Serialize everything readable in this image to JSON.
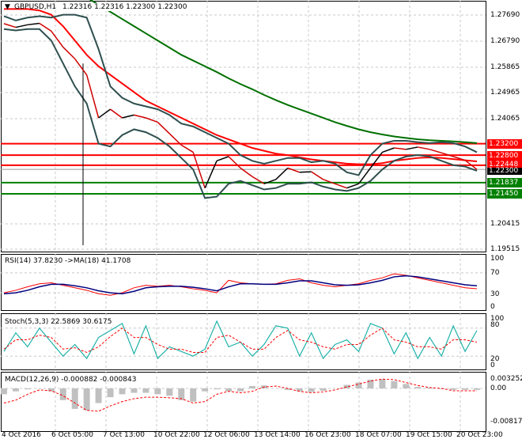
{
  "header": {
    "symbol": "GBPUSD,H1",
    "ohlc": "1.22316 1.22316 1.22300 1.22300"
  },
  "price_axis": [
    "1.27690",
    "1.26790",
    "1.25865",
    "1.24965",
    "1.24065",
    "1.20415",
    "1.19515"
  ],
  "levels": [
    {
      "label": "1.23200",
      "value": 1.232,
      "color": "#ff0000"
    },
    {
      "label": "1.22800",
      "value": 1.228,
      "color": "#ff0000"
    },
    {
      "label": "1.22448",
      "value": 1.22448,
      "color": "#ff0000"
    },
    {
      "label": "1.21837",
      "value": 1.21837,
      "color": "#008000"
    },
    {
      "label": "1.21450",
      "value": 1.2145,
      "color": "#008000"
    }
  ],
  "current_price": {
    "label": "1.22300",
    "value": 1.223
  },
  "rsi": {
    "title": "RSI(14) 37.8230  ->MA(18) 41.1708",
    "axis": [
      "100",
      "70",
      "30",
      "0"
    ]
  },
  "stoch": {
    "title": "Stoch(5,3,3) 22.5869 30.6175",
    "axis": [
      "100",
      "80",
      "20",
      "0"
    ]
  },
  "macd": {
    "title": "MACD(12,26,9) -0.000882 -0.000843",
    "axis": [
      "0.003252",
      "0.00",
      "-0.008171"
    ]
  },
  "time_axis": [
    "4 Oct 2016",
    "6 Oct 05:00",
    "7 Oct 13:00",
    "10 Oct 22:00",
    "12 Oct 06:00",
    "13 Oct 14:00",
    "16 Oct 23:00",
    "18 Oct 07:00",
    "19 Oct 15:00",
    "20 Oct 23:00"
  ],
  "chart_data": {
    "type": "line",
    "price": [
      1.2739,
      1.2726,
      1.2735,
      1.274,
      1.2713,
      1.2657,
      1.2616,
      1.256,
      1.241,
      1.244,
      1.241,
      1.242,
      1.241,
      1.2395,
      1.2355,
      1.2315,
      1.229,
      1.2165,
      1.226,
      1.2275,
      1.2235,
      1.2205,
      1.218,
      1.2195,
      1.2235,
      1.222,
      1.2222,
      1.2195,
      1.218,
      1.2165,
      1.218,
      1.2235,
      1.229,
      1.2305,
      1.23,
      1.2308,
      1.23,
      1.2288,
      1.2275,
      1.2262,
      1.223
    ],
    "ma_red": [
      1.279,
      1.279,
      1.279,
      1.2785,
      1.277,
      1.273,
      1.268,
      1.263,
      1.259,
      1.256,
      1.253,
      1.25,
      1.247,
      1.245,
      1.243,
      1.241,
      1.239,
      1.237,
      1.235,
      1.2335,
      1.232,
      1.2305,
      1.2295,
      1.2285,
      1.228,
      1.2272,
      1.2265,
      1.226,
      1.2255,
      1.225,
      1.2248,
      1.2248,
      1.2252,
      1.226,
      1.2265,
      1.227,
      1.2272,
      1.227,
      1.2266,
      1.2262,
      1.2258
    ],
    "ma_green": [
      1.285,
      1.285,
      1.285,
      1.285,
      1.285,
      1.285,
      1.284,
      1.283,
      1.2805,
      1.278,
      1.2755,
      1.273,
      1.2705,
      1.268,
      1.2655,
      1.263,
      1.261,
      1.259,
      1.257,
      1.2548,
      1.2528,
      1.251,
      1.249,
      1.2472,
      1.2455,
      1.244,
      1.2425,
      1.241,
      1.2395,
      1.2382,
      1.237,
      1.236,
      1.2352,
      1.2345,
      1.234,
      1.2335,
      1.2332,
      1.233,
      1.2328,
      1.2325,
      1.2322
    ],
    "bb_upper": [
      1.2765,
      1.275,
      1.276,
      1.2765,
      1.276,
      1.277,
      1.277,
      1.276,
      1.265,
      1.252,
      1.248,
      1.246,
      1.245,
      1.244,
      1.242,
      1.239,
      1.238,
      1.236,
      1.234,
      1.232,
      1.228,
      1.226,
      1.225,
      1.226,
      1.227,
      1.227,
      1.2255,
      1.226,
      1.225,
      1.222,
      1.221,
      1.228,
      1.232,
      1.233,
      1.233,
      1.2325,
      1.2322,
      1.2325,
      1.2322,
      1.231,
      1.229
    ],
    "bb_lower": [
      1.272,
      1.2715,
      1.272,
      1.272,
      1.268,
      1.26,
      1.252,
      1.246,
      1.232,
      1.231,
      1.235,
      1.237,
      1.236,
      1.234,
      1.231,
      1.227,
      1.223,
      1.213,
      1.2135,
      1.218,
      1.219,
      1.2175,
      1.216,
      1.2165,
      1.218,
      1.218,
      1.2185,
      1.217,
      1.216,
      1.2155,
      1.2165,
      1.219,
      1.223,
      1.226,
      1.2275,
      1.228,
      1.2275,
      1.226,
      1.2245,
      1.224,
      1.2225
    ],
    "rsi": [
      30,
      35,
      42,
      48,
      50,
      45,
      40,
      35,
      28,
      25,
      30,
      40,
      45,
      43,
      45,
      42,
      38,
      35,
      30,
      55,
      50,
      48,
      47,
      48,
      55,
      58,
      50,
      45,
      42,
      45,
      48,
      55,
      60,
      68,
      65,
      60,
      55,
      50,
      45,
      40,
      38
    ],
    "rsi_ma": [
      28,
      30,
      35,
      42,
      47,
      47,
      44,
      40,
      34,
      30,
      28,
      33,
      40,
      42,
      43,
      43,
      41,
      38,
      34,
      42,
      48,
      48,
      47,
      47,
      50,
      54,
      54,
      50,
      46,
      45,
      46,
      50,
      55,
      62,
      64,
      62,
      58,
      54,
      50,
      46,
      44
    ],
    "stoch_main": [
      30,
      70,
      40,
      80,
      50,
      20,
      45,
      15,
      60,
      75,
      90,
      25,
      85,
      15,
      40,
      30,
      20,
      35,
      95,
      40,
      50,
      20,
      45,
      85,
      80,
      20,
      70,
      15,
      45,
      55,
      30,
      90,
      80,
      25,
      70,
      15,
      60,
      20,
      85,
      30,
      75
    ],
    "stoch_signal": [
      35,
      55,
      55,
      65,
      60,
      35,
      38,
      28,
      40,
      62,
      80,
      60,
      60,
      45,
      35,
      35,
      28,
      28,
      60,
      65,
      50,
      35,
      35,
      60,
      75,
      55,
      50,
      40,
      35,
      45,
      45,
      65,
      80,
      55,
      50,
      40,
      40,
      35,
      55,
      55,
      50
    ],
    "macd_main": [
      -0.002,
      -0.001,
      -0.0003,
      0,
      -0.001,
      -0.004,
      -0.007,
      -0.0075,
      -0.005,
      -0.003,
      -0.002,
      -0.0015,
      -0.0015,
      -0.002,
      -0.0025,
      -0.004,
      -0.0045,
      -0.001,
      -0.0003,
      -0.001,
      -0.001,
      0.0008,
      0.001,
      0,
      -0.0005,
      -0.001,
      -0.0012,
      -0.0008,
      0,
      0.0012,
      0.002,
      0.003,
      0.0032,
      0.0025,
      0.0015,
      0.0005,
      0.0003,
      -0.0002,
      -0.0005,
      -0.0005,
      -0.0005
    ],
    "macd_signal": [
      -0.005,
      -0.004,
      -0.002,
      -0.0005,
      -0.0008,
      -0.0025,
      -0.005,
      -0.0075,
      -0.0078,
      -0.006,
      -0.0045,
      -0.0035,
      -0.003,
      -0.003,
      -0.0032,
      -0.0035,
      -0.005,
      -0.0045,
      -0.002,
      -0.001,
      -0.0015,
      -0.001,
      0.0005,
      0.0008,
      0,
      -0.001,
      -0.0015,
      -0.0012,
      -0.0005,
      0.0005,
      0.0015,
      0.0025,
      0.0032,
      0.003,
      0.002,
      0.001,
      0.0003,
      0,
      -0.0008,
      -0.0008,
      -0.0008
    ]
  }
}
